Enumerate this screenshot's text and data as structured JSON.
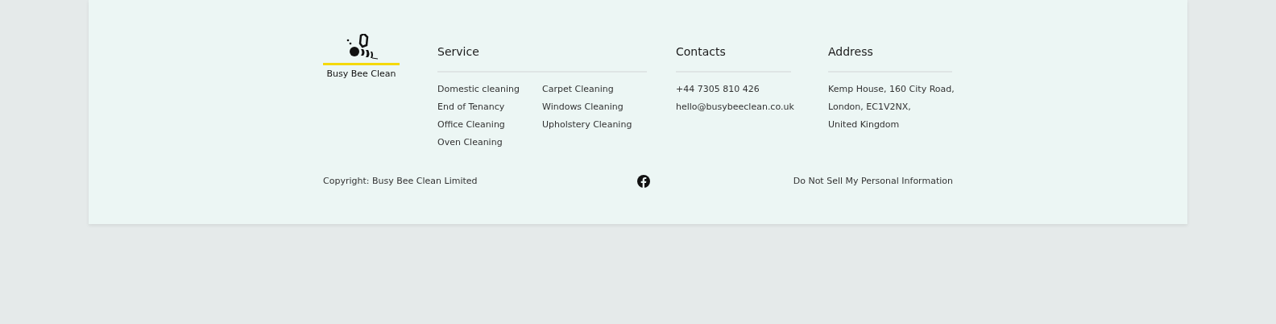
{
  "logo": {
    "name": "Busy Bee Clean"
  },
  "service": {
    "title": "Service",
    "columns": [
      [
        "Domestic cleaning",
        "End of Tenancy",
        "Office Cleaning",
        "Oven Cleaning"
      ],
      [
        "Carpet Cleaning",
        "Windows Cleaning",
        "Upholstery Cleaning"
      ]
    ]
  },
  "contacts": {
    "title": "Contacts",
    "items": [
      "+44 7305 810 426",
      "hello@busybeeclean.co.uk"
    ]
  },
  "address": {
    "title": "Address",
    "lines": [
      "Kemp House, 160 City Road,",
      "London, EC1V2NX,",
      "United Kingdom"
    ]
  },
  "bottom": {
    "copyright": "Copyright: Busy Bee Clean Limited",
    "link": "Do Not Sell My Personal Information"
  }
}
